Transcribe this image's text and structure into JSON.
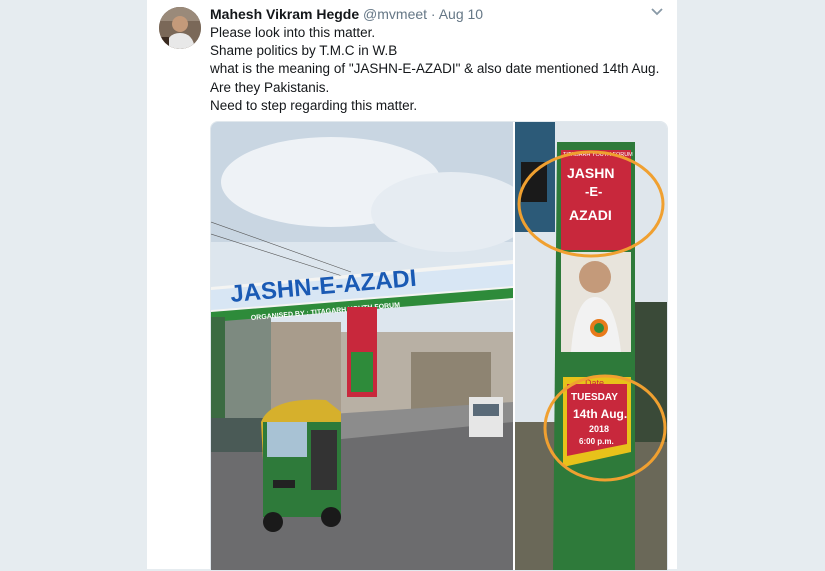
{
  "tweet": {
    "author_name": "Mahesh Vikram Hegde",
    "author_handle": "@mvmeet",
    "separator": "·",
    "time": "Aug 10",
    "lines": [
      "Please look into this matter.",
      "Shame politics by T.M.C in W.B",
      "what is the meaning of \"JASHN-E-AZADI\" & also date mentioned 14th Aug.",
      "Are they Pakistanis.",
      "Need to step regarding this matter."
    ]
  },
  "icons": {
    "menu": "chevron-down-icon",
    "avatar": "avatar"
  },
  "media": {
    "left_photo": {
      "banner_main": "JASHN-E-AZADI",
      "banner_sub": "ORGANISED BY : TITAGARH YOUTH FORUM"
    },
    "right_photo": {
      "sign_top": "TITAGARH YOUTH FORUM",
      "sign_words": [
        "JASHN",
        "-E-",
        "AZADI"
      ],
      "date_label": "Date",
      "day": "TUESDAY",
      "date": "14th Aug.",
      "year": "2018",
      "time": "6:00 p.m."
    }
  },
  "colors": {
    "accent": "#1da1f2",
    "circle": "#f0a030",
    "sign_red": "#c8283c",
    "banner_blue": "#1a5ab4"
  }
}
